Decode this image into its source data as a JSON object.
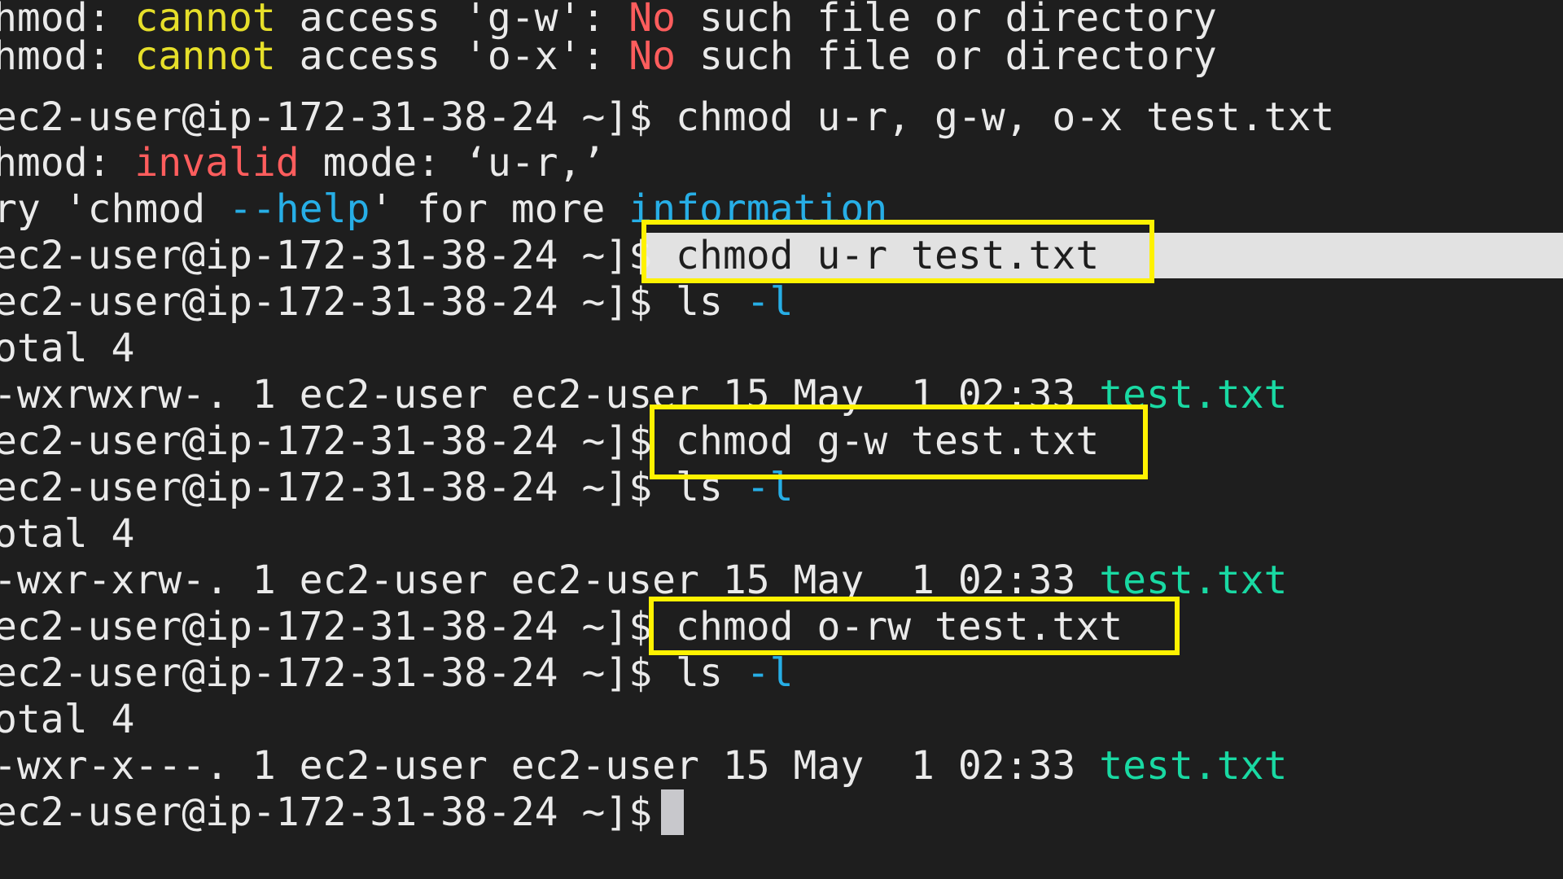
{
  "terminal": {
    "lines": [
      {
        "segments": [
          "hmod: ",
          "cannot",
          " access 'g-w': ",
          "No",
          " such file or directory"
        ]
      },
      {
        "segments": [
          "hmod: ",
          "cannot",
          " access 'o-x': ",
          "No",
          " such file or directory"
        ]
      },
      {
        "segments": [
          "ec2-user@ip-172-31-38-24 ~]$ chmod u-r, g-w, o-x test.txt"
        ]
      },
      {
        "segments": [
          "hmod: ",
          "invalid",
          " mode: ‘u-r,’"
        ]
      },
      {
        "segments": [
          "ry 'chmod ",
          "--help",
          "' for more ",
          "information"
        ]
      },
      {
        "segments": [
          "ec2-user@ip-172-31-38-24 ~]$",
          " chmod u-r test.txt"
        ]
      },
      {
        "segments": [
          "ec2-user@ip-172-31-38-24 ~]$ ls ",
          "-l"
        ]
      },
      {
        "segments": [
          "otal 4"
        ]
      },
      {
        "segments": [
          "-wxrwxrw-. 1 ec2-user ec2-user 15 May  1 02:33 ",
          "test.txt"
        ]
      },
      {
        "segments": [
          "ec2-user@ip-172-31-38-24 ~]$ chmod g-w test.txt"
        ]
      },
      {
        "segments": [
          "ec2-user@ip-172-31-38-24 ~]$ ls ",
          "-l"
        ]
      },
      {
        "segments": [
          "otal 4"
        ]
      },
      {
        "segments": [
          "-wxr-xrw-. 1 ec2-user ec2-user 15 May  1 02:33 ",
          "test.txt"
        ]
      },
      {
        "segments": [
          "ec2-user@ip-172-31-38-24 ~]$ chmod o-rw test.txt"
        ]
      },
      {
        "segments": [
          "ec2-user@ip-172-31-38-24 ~]$ ls ",
          "-l"
        ]
      },
      {
        "segments": [
          "otal 4"
        ]
      },
      {
        "segments": [
          "-wxr-x---. 1 ec2-user ec2-user 15 May  1 02:33 ",
          "test.txt"
        ]
      },
      {
        "segments": [
          "ec2-user@ip-172-31-38-24 ~]$ "
        ]
      }
    ]
  },
  "colors": {
    "background": "#1e1e1e",
    "text": "#eaeaea",
    "warning": "#e6df2a",
    "error": "#ff5d5d",
    "option": "#27aee6",
    "file": "#19d9a3",
    "highlight_box": "#fff200"
  }
}
